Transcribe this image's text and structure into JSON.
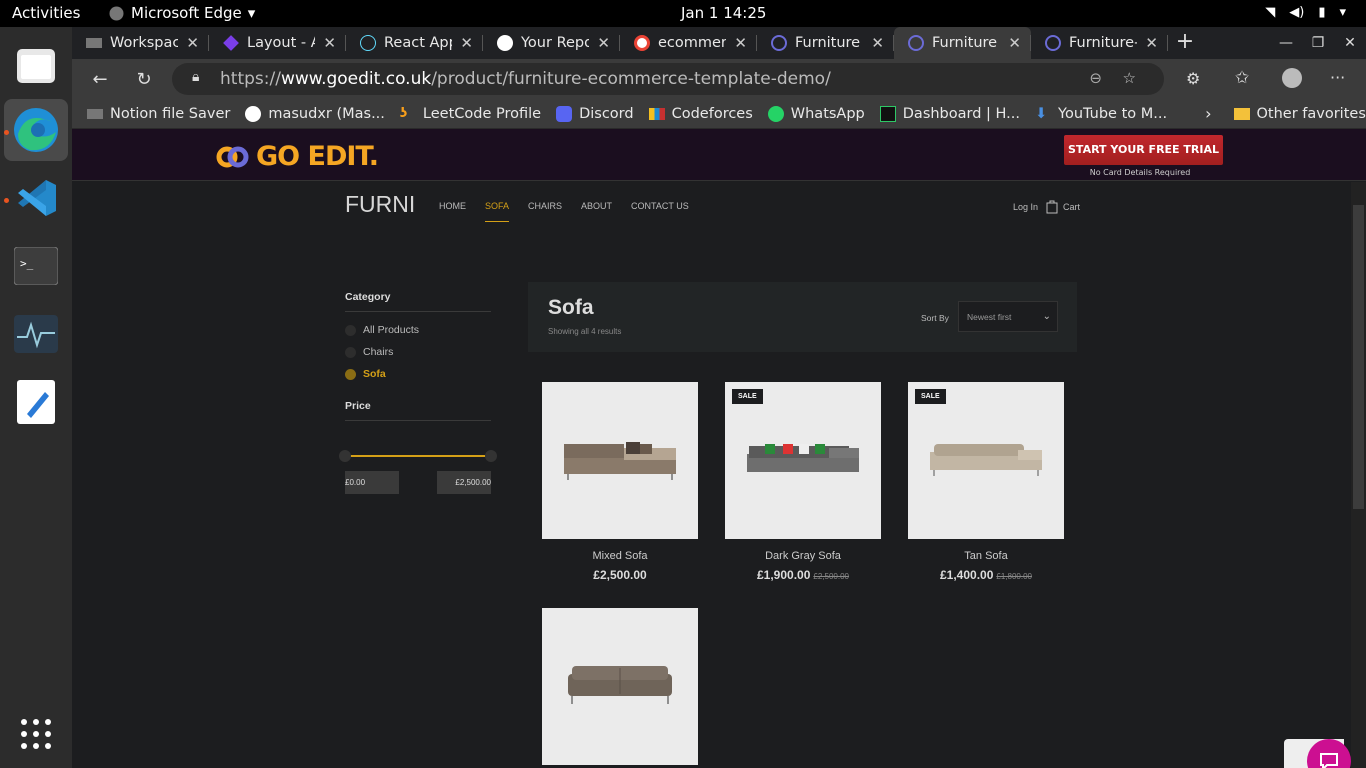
{
  "os": {
    "activities": "Activities",
    "app_name": "Microsoft Edge",
    "clock": "Jan 1  14:25"
  },
  "dock": {
    "items": [
      "files-icon",
      "edge-icon",
      "vscode-icon",
      "terminal-icon",
      "system-monitor-icon",
      "text-editor-icon",
      "app-grid-icon"
    ]
  },
  "tabs": [
    {
      "title": "Workspace"
    },
    {
      "title": "Layout - An"
    },
    {
      "title": "React App"
    },
    {
      "title": "Your Repos"
    },
    {
      "title": "ecommerce"
    },
    {
      "title": "Furniture E"
    },
    {
      "title": "Furniture E"
    },
    {
      "title": "Furniture-e"
    }
  ],
  "address": {
    "prefix": "https://",
    "domain": "www.goedit.co.uk",
    "path": "/product/furniture-ecommerce-template-demo/"
  },
  "bookmarks": [
    "Notion file Saver",
    "masudxr (Mas...",
    "LeetCode Profile",
    "Discord",
    "Codeforces",
    "WhatsApp",
    "Dashboard | H...",
    "YouTube to M...",
    "Other favorites"
  ],
  "banner": {
    "logo": "GO EDIT.",
    "cta": "START YOUR FREE TRIAL",
    "cta_sub": "No Card Details Required"
  },
  "site": {
    "brand": "FURNI",
    "menu": [
      "HOME",
      "SOFA",
      "CHAIRS",
      "ABOUT",
      "CONTACT US"
    ],
    "login": "Log In",
    "cart": "Cart"
  },
  "sidebar": {
    "category_title": "Category",
    "categories": [
      "All Products",
      "Chairs",
      "Sofa"
    ],
    "price_title": "Price",
    "min": "£0.00",
    "max": "£2,500.00"
  },
  "listing": {
    "title": "Sofa",
    "count": "Showing all 4 results",
    "sort_label": "Sort By",
    "sort_value": "Newest first"
  },
  "products": [
    {
      "name": "Mixed Sofa",
      "price": "£2,500.00",
      "old": "",
      "sale": ""
    },
    {
      "name": "Dark Gray Sofa",
      "price": "£1,900.00",
      "old": "£2,500.00",
      "sale": "SALE"
    },
    {
      "name": "Tan Sofa",
      "price": "£1,400.00",
      "old": "£1,800.00",
      "sale": "SALE"
    },
    {
      "name": "",
      "price": "",
      "old": "",
      "sale": ""
    }
  ],
  "colors": {
    "accent": "#d4a017",
    "cta": "#c1272d",
    "chat": "#cc0f91"
  }
}
